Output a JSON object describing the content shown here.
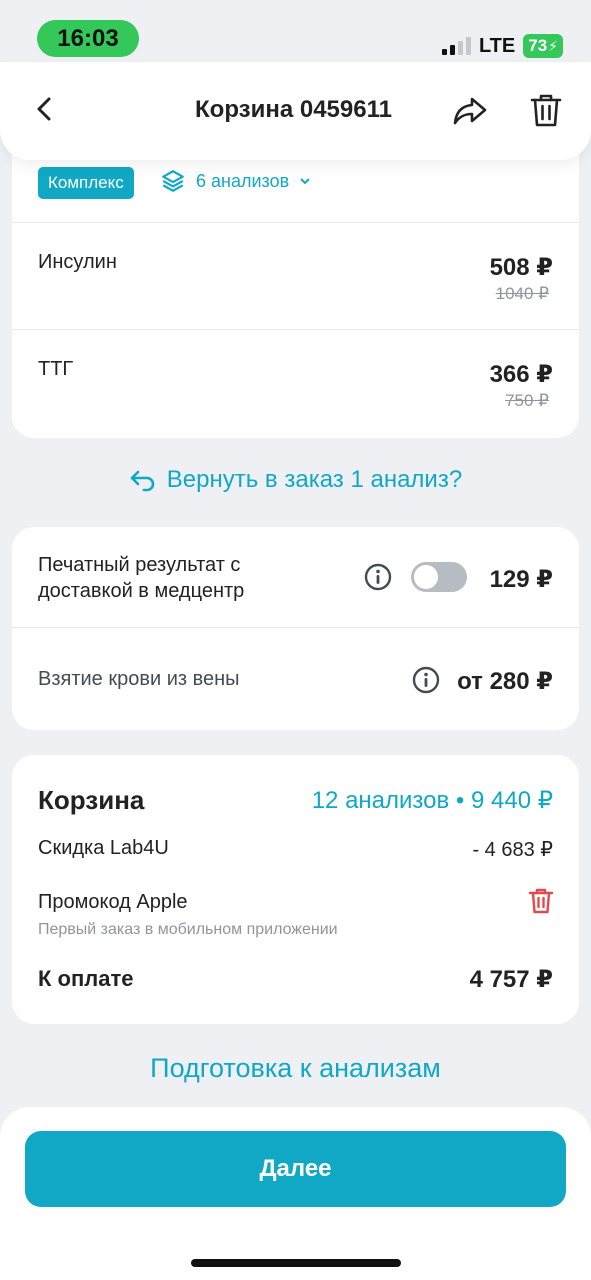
{
  "status_bar": {
    "time": "16:03",
    "network": "LTE",
    "battery": "73"
  },
  "header": {
    "title": "Корзина 0459611"
  },
  "bundle": {
    "badge": "Комплекс",
    "analyses_link": "6 анализов"
  },
  "items": [
    {
      "name": "Инсулин",
      "price": "508 ₽",
      "old_price": "1040 ₽"
    },
    {
      "name": "ТТГ",
      "price": "366 ₽",
      "old_price": "750 ₽"
    }
  ],
  "return_link": "Вернуть в заказ 1 анализ?",
  "options": {
    "printed_line1": "Печатный результат с",
    "printed_line2": "доставкой в медцентр",
    "printed_price": "129 ₽",
    "printed_enabled": false,
    "blood_label": "Взятие крови из вены",
    "blood_price": "от 280 ₽"
  },
  "summary": {
    "title": "Корзина",
    "count_price": "12 анализов • 9 440 ₽",
    "discount_label": "Скидка Lab4U",
    "discount_value": "- 4 683 ₽",
    "promo_label": "Промокод Apple",
    "promo_sub": "Первый заказ в мобильном приложении",
    "pay_label": "К оплате",
    "pay_value": "4 757 ₽"
  },
  "prep_link": "Подготовка к анализам",
  "next_button": "Далее",
  "colors": {
    "accent": "#10a8c5",
    "danger": "#e5484d",
    "status_green": "#34c759"
  }
}
